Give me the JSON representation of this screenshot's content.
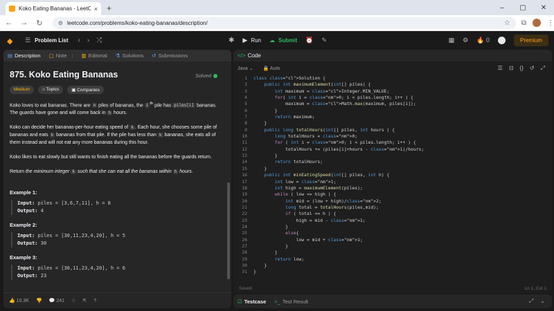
{
  "browser": {
    "tab_title": "Koko Eating Bananas - LeetCode",
    "tab_close": "×",
    "new_tab": "+",
    "url": "leetcode.com/problems/koko-eating-bananas/description/",
    "controls": {
      "minimize": "–",
      "maximize": "▢",
      "close": "✕"
    }
  },
  "appnav": {
    "problem_list": "Problem List",
    "run": "Run",
    "submit": "Submit",
    "streak": "0",
    "premium": "Premium"
  },
  "left": {
    "tabs": [
      "Description",
      "Note",
      "Editorial",
      "Solutions",
      "Submissions"
    ],
    "title": "875. Koko Eating Bananas",
    "solved": "Solved",
    "difficulty": "Medium",
    "topics": "Topics",
    "companies": "Companies",
    "p1": {
      "a": "Koko loves to eat bananas. There are ",
      "n": "n",
      "b": " piles of bananas, the ",
      "ith": "i",
      "th": "th",
      "c": " pile has ",
      "pi": "piles[i]",
      "d": " bananas. The guards have gone and will come back in ",
      "h": "h",
      "e": " hours."
    },
    "p2": {
      "a": "Koko can decide her bananas-per-hour eating speed of ",
      "k": "k",
      "b": ". Each hour, she chooses some pile of bananas and eats ",
      "k2": "k",
      "c": " bananas from that pile. If the pile has less than ",
      "k3": "k",
      "d": " bananas, she eats all of them instead and will not eat any more bananas during this hour."
    },
    "p3": "Koko likes to eat slowly but still wants to finish eating all the bananas before the guards return.",
    "p4": {
      "a": "Return ",
      "b": "the minimum integer",
      "k": "k",
      "c": "such that she can eat all the bananas within",
      "h": "h",
      "d": "hours."
    },
    "examples": [
      {
        "label": "Example 1:",
        "input_label": "Input:",
        "input": "piles = [3,6,7,11], h = 8",
        "output_label": "Output:",
        "output": "4"
      },
      {
        "label": "Example 2:",
        "input_label": "Input:",
        "input": "piles = [30,11,23,4,20], h = 5",
        "output_label": "Output:",
        "output": "30"
      },
      {
        "label": "Example 3:",
        "input_label": "Input:",
        "input": "piles = [30,11,23,4,20], h = 6",
        "output_label": "Output:",
        "output": "23"
      }
    ],
    "footer": {
      "likes": "10.3K",
      "comments": "241"
    }
  },
  "right": {
    "tab": "Code",
    "language": "Java",
    "mode": "Auto",
    "status_left": "Saved",
    "status_right": "Ln 1, Col 1",
    "code_lines": [
      "class Solution {",
      "    public int maximumElement(int[] piles) {",
      "        int maximum = Integer.MIN_VALUE;",
      "        for( int i = 0; i < piles.length; i++ ) {",
      "            maximum = Math.max(maximum, piles[i]);",
      "        }",
      "        return maximum;",
      "    }",
      "    public long totalHours(int[] piles, int hours ) {",
      "        long totalHours = 0;",
      "        for ( int i = 0; i < piles.length; i++ ) {",
      "            totalHours += (piles[i]+hours - 1)/hours;",
      "        }",
      "        return totalHours;",
      "    }",
      "    public int minEatingSpeed(int[] piles, int h) {",
      "        int low = 1;",
      "        int high = maximumElement(piles);",
      "        while ( low <= high ) {",
      "            int mid = (low + high)/2;",
      "            long total = totalHours(piles,mid);",
      "            if ( total <= h ) {",
      "                high = mid - 1;",
      "            }",
      "            else{",
      "                low = mid + 1;",
      "            }",
      "        }",
      "        return low;",
      "    }",
      "}"
    ]
  },
  "testcase": {
    "tab1": "Testcase",
    "tab2": "Test Result"
  }
}
